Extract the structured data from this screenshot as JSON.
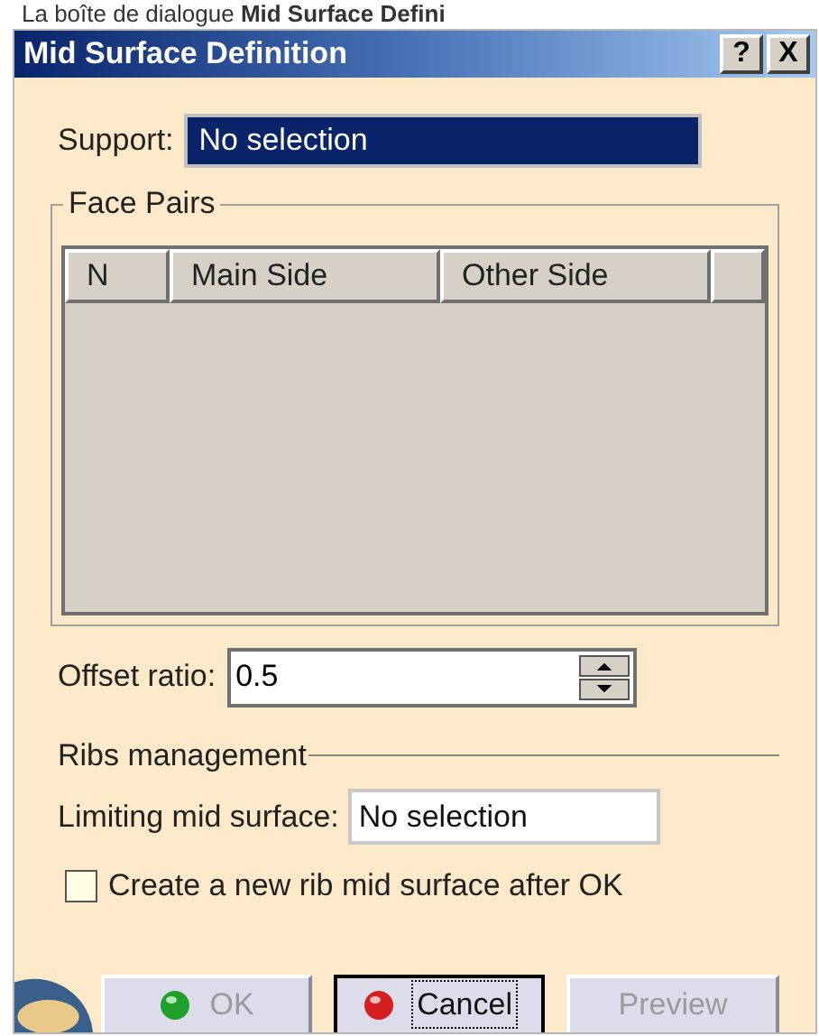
{
  "caption": "La boîte de dialogue **Mid Surface Defini**",
  "window": {
    "title": "Mid Surface Definition",
    "title_buttons": [
      "?",
      "X"
    ]
  },
  "support": {
    "label": "Support:",
    "value": "No selection",
    "selected": true
  },
  "face_pairs": {
    "title": "Face Pairs",
    "columns": [
      "N",
      "Main Side",
      "Other Side"
    ]
  },
  "offset_ratio": {
    "label": "Offset ratio:",
    "value": "0.5"
  },
  "ribs_management": {
    "title": "Ribs management"
  },
  "limiting_mid_surface": {
    "label": "Limiting mid surface:",
    "value": "No selection",
    "selected": false
  },
  "option": {
    "label": "Create a new rib mid surface after OK",
    "checked": false
  },
  "buttons": [
    {
      "label": "OK",
      "kind": "ok",
      "disabled": true,
      "focused": false
    },
    {
      "label": "Cancel",
      "kind": "cancel",
      "disabled": false,
      "focused": true
    },
    {
      "label": "Preview",
      "kind": "preview",
      "disabled": true,
      "focused": false
    }
  ]
}
